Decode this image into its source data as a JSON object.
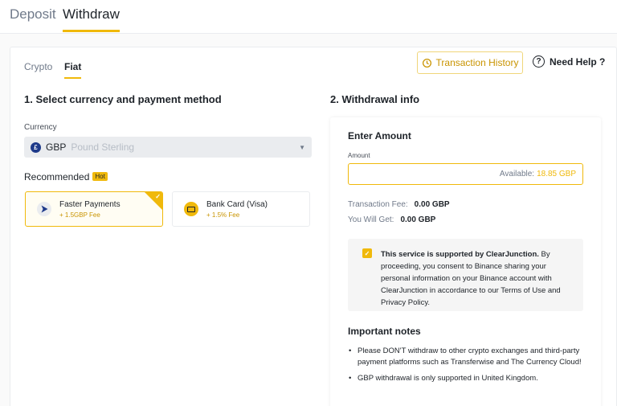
{
  "top_tabs": {
    "deposit": "Deposit",
    "withdraw": "Withdraw"
  },
  "sub_tabs": {
    "crypto": "Crypto",
    "fiat": "Fiat"
  },
  "header": {
    "history": "Transaction History",
    "help": "Need Help ?",
    "help_glyph": "?"
  },
  "left": {
    "title": "1. Select currency and payment method",
    "currency_label": "Currency",
    "currency_symbol": "£",
    "currency_code": "GBP",
    "currency_name": "Pound Sterling",
    "recommended": "Recommended",
    "hot": "Hot",
    "methods": [
      {
        "name": "Faster Payments",
        "fee": "+ 1.5GBP Fee"
      },
      {
        "name": "Bank Card (Visa)",
        "fee": "+ 1.5% Fee"
      }
    ]
  },
  "right": {
    "title": "2. Withdrawal info",
    "enter_amount": "Enter Amount",
    "amount_label": "Amount",
    "amount_value": "",
    "available_label": "Available:",
    "available_value": "18.85 GBP",
    "fee_label": "Transaction Fee:",
    "fee_value": "0.00 GBP",
    "get_label": "You Will Get:",
    "get_value": "0.00 GBP",
    "consent_bold": "This service is supported by ClearJunction.",
    "consent_rest": " By proceeding, you consent to Binance sharing your personal information on your Binance account with ClearJunction in accordance to our Terms of Use and Privacy Policy.",
    "notes_title": "Important notes",
    "notes": [
      "Please DON'T withdraw to other crypto exchanges and third-party payment platforms such as Transferwise and The Currency Cloud!",
      "GBP withdrawal is only supported in United Kingdom."
    ]
  },
  "colors": {
    "accent": "#f0b90b",
    "accent_text": "#c99400",
    "text": "#1e2329",
    "muted": "#707a8a"
  },
  "icons": {
    "history": "history-icon",
    "help": "help-circle-icon",
    "currency": "pound-icon",
    "faster_payments": "arrow-play-icon",
    "bank_card": "credit-card-icon",
    "selected": "check-icon",
    "consent": "checkbox-checked-icon"
  }
}
